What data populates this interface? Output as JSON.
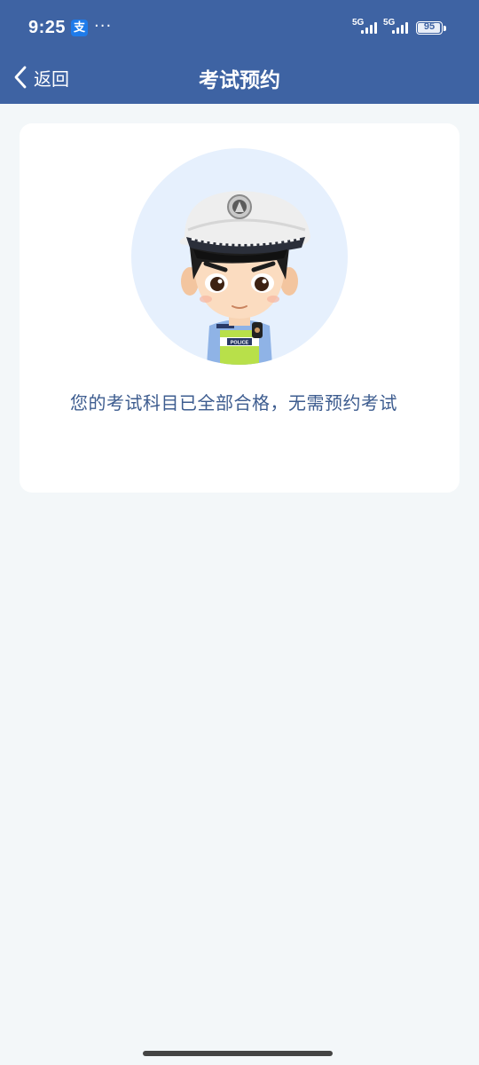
{
  "status_bar": {
    "time": "9:25",
    "alipay_badge": "支",
    "more": "···",
    "network_1": "5G",
    "network_2": "5G",
    "battery": "95"
  },
  "nav": {
    "back_label": "返回",
    "title": "考试预约"
  },
  "card": {
    "avatar_badge_text": "POLICE",
    "message": "您的考试科目已全部合格，无需预约考试"
  },
  "colors": {
    "header": "#3e63a3",
    "background": "#f3f7f9",
    "message_text": "#3d5c8f"
  }
}
